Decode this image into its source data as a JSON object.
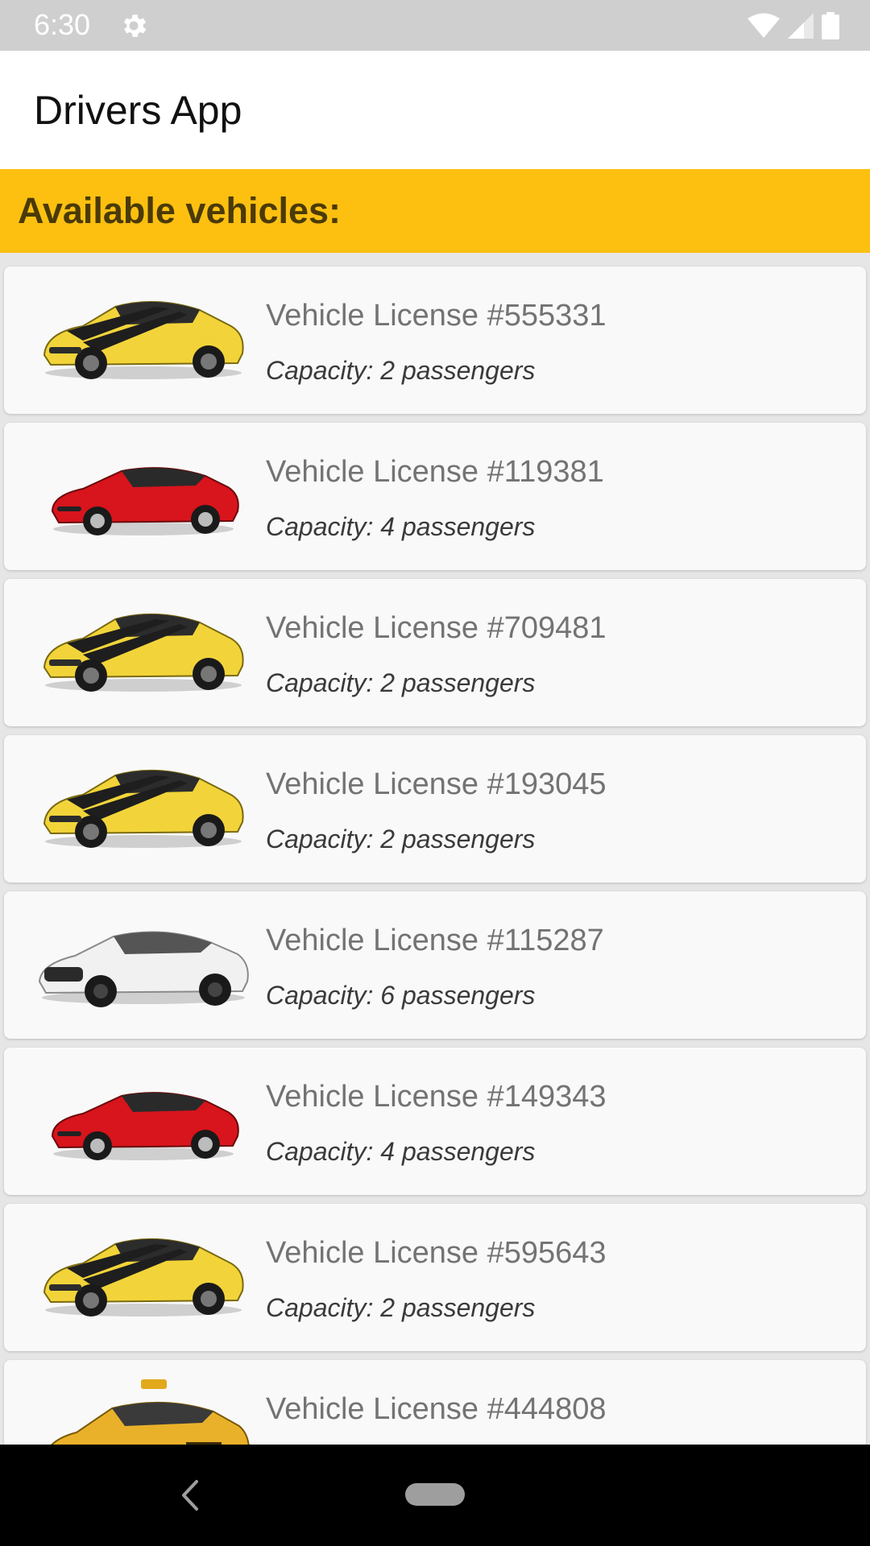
{
  "status_bar": {
    "time": "6:30",
    "icons": [
      "settings-gear-icon",
      "wifi-icon",
      "cell-signal-icon",
      "battery-icon"
    ]
  },
  "app_bar": {
    "title": "Drivers App"
  },
  "section": {
    "title": "Available vehicles:",
    "color": "#FDC010"
  },
  "vehicles": [
    {
      "license": "Vehicle License #555331",
      "capacity": "Capacity: 2 passengers",
      "image": "yellow-sports-car"
    },
    {
      "license": "Vehicle License #119381",
      "capacity": "Capacity: 4 passengers",
      "image": "red-sports-car"
    },
    {
      "license": "Vehicle License #709481",
      "capacity": "Capacity: 2 passengers",
      "image": "yellow-sports-car"
    },
    {
      "license": "Vehicle License #193045",
      "capacity": "Capacity: 2 passengers",
      "image": "yellow-sports-car"
    },
    {
      "license": "Vehicle License #115287",
      "capacity": "Capacity: 6 passengers",
      "image": "white-coupe"
    },
    {
      "license": "Vehicle License #149343",
      "capacity": "Capacity: 4 passengers",
      "image": "red-sports-car"
    },
    {
      "license": "Vehicle License #595643",
      "capacity": "Capacity: 2 passengers",
      "image": "yellow-sports-car"
    },
    {
      "license": "Vehicle License #444808",
      "capacity": "",
      "image": "yellow-taxi"
    }
  ],
  "nav_bar": {
    "icons": [
      "back-icon",
      "home-pill-icon"
    ]
  }
}
